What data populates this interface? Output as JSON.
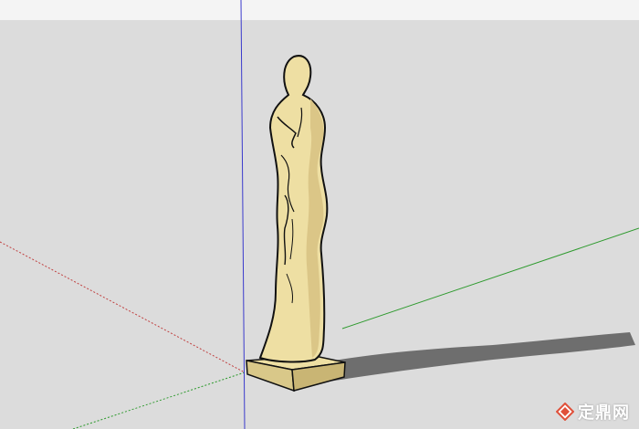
{
  "viewport": {
    "background_color": "#dcdcdc",
    "sky_color": "#f4f4f4"
  },
  "axes": {
    "red_axis_color": "#c04040",
    "green_axis_color": "#2e9a2e",
    "blue_axis_color": "#3a3acc"
  },
  "model": {
    "name": "statue-figure",
    "fill_color": "#eedfa3",
    "shade_color": "#cdb877",
    "edge_color": "#111111",
    "shadow_color": "#5a5a5a"
  },
  "watermark": {
    "text": "定鼎网",
    "icon": "diamond-logo-icon",
    "logo_color": "#e0503a"
  }
}
